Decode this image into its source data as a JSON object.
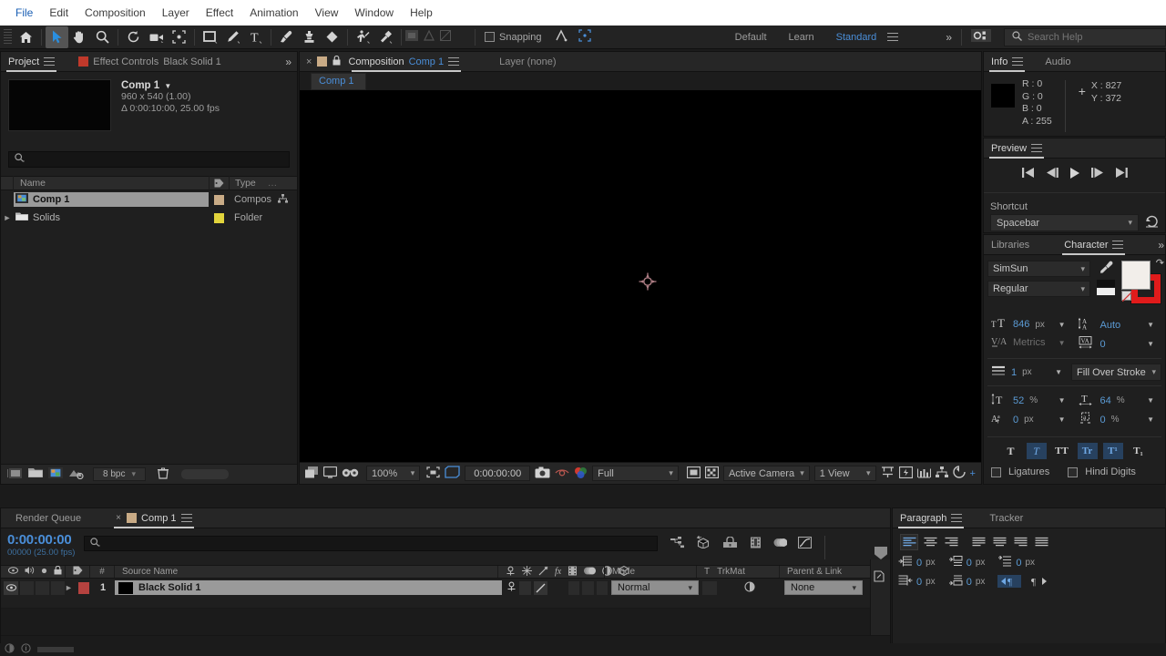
{
  "menubar": {
    "items": [
      "File",
      "Edit",
      "Composition",
      "Layer",
      "Effect",
      "Animation",
      "View",
      "Window",
      "Help"
    ]
  },
  "toolbar": {
    "tools": [
      {
        "name": "home-icon",
        "label": "Home"
      },
      {
        "name": "selection-tool-icon",
        "label": "Selection Tool"
      },
      {
        "name": "hand-tool-icon",
        "label": "Hand Tool"
      },
      {
        "name": "zoom-tool-icon",
        "label": "Zoom Tool"
      },
      {
        "name": "rotation-tool-icon",
        "label": "Rotation Tool"
      },
      {
        "name": "camera-tool-icon",
        "label": "Unified Camera Tool"
      },
      {
        "name": "pan-behind-tool-icon",
        "label": "Pan Behind Tool"
      },
      {
        "name": "shape-tool-icon",
        "label": "Rectangle Tool"
      },
      {
        "name": "pen-tool-icon",
        "label": "Pen Tool"
      },
      {
        "name": "type-tool-icon",
        "label": "Type Tool"
      },
      {
        "name": "brush-tool-icon",
        "label": "Brush Tool"
      },
      {
        "name": "clone-stamp-tool-icon",
        "label": "Clone Stamp Tool"
      },
      {
        "name": "eraser-tool-icon",
        "label": "Eraser Tool"
      },
      {
        "name": "roto-brush-tool-icon",
        "label": "Roto Brush Tool"
      },
      {
        "name": "puppet-pin-tool-icon",
        "label": "Puppet Pin Tool"
      }
    ],
    "snapping_label": "Snapping",
    "workspaces": [
      "Default",
      "Learn",
      "Standard"
    ],
    "active_workspace": "Standard",
    "overflow_label": "»",
    "search_placeholder": "Search Help",
    "search_value": ""
  },
  "project": {
    "tabs": [
      {
        "label": "Project",
        "active": true
      },
      {
        "label": "Effect Controls",
        "active": false
      },
      {
        "label": "Black Solid 1",
        "active": false
      }
    ],
    "overflow": "»",
    "header": {
      "title": "Comp 1",
      "resolution": "960 x 540 (1.00)",
      "duration": "Δ 0:00:10:00, 25.00 fps"
    },
    "search_placeholder": "",
    "columns": [
      "Name",
      "Type"
    ],
    "rows": [
      {
        "name": "Comp 1",
        "type": "Compos",
        "swatch": "#c9ab86",
        "selected": true,
        "expandable": false
      },
      {
        "name": "Solids",
        "type": "Folder",
        "swatch": "#e2d43c",
        "selected": false,
        "expandable": true
      }
    ],
    "footer": {
      "bit_depth": "8 bpc"
    }
  },
  "composition": {
    "tab_close": "×",
    "tab_label": "Composition",
    "tab_comp_name": "Comp 1",
    "layer_label": "Layer  (none)",
    "breadcrumb": "Comp 1",
    "footer": {
      "zoom": "100%",
      "timecode": "0:00:00:00",
      "resolution": "Full",
      "camera": "Active Camera",
      "views": "1 View"
    }
  },
  "info": {
    "tabs": [
      {
        "label": "Info",
        "active": true
      },
      {
        "label": "Audio",
        "active": false
      }
    ],
    "color_swatch": "#000000",
    "r": "R : 0",
    "g": "G : 0",
    "b": "B : 0",
    "a": "A : 255",
    "x": "X : 827",
    "y": "Y : 372"
  },
  "preview": {
    "tab": "Preview",
    "shortcut_label": "Shortcut",
    "shortcut_value": "Spacebar",
    "transport": [
      "first-frame",
      "prev-frame",
      "play",
      "next-frame",
      "last-frame"
    ]
  },
  "character": {
    "tabs": [
      {
        "label": "Libraries",
        "active": false
      },
      {
        "label": "Character",
        "active": true
      }
    ],
    "overflow": "»",
    "font_family": "SimSun",
    "font_style": "Regular",
    "font_size": "846",
    "font_size_unit": "px",
    "leading": "Auto",
    "kerning": "Metrics",
    "tracking": "0",
    "stroke_width": "1",
    "stroke_width_unit": "px",
    "fill_stroke_order": "Fill Over Stroke",
    "vertical_scale": "52",
    "vertical_scale_unit": "%",
    "horizontal_scale": "64",
    "horizontal_scale_unit": "%",
    "baseline_shift": "0",
    "baseline_shift_unit": "px",
    "tsume": "0",
    "tsume_unit": "%",
    "style_buttons": [
      "T",
      "T",
      "TT",
      "Tr",
      "T¹",
      "T₁"
    ],
    "ligatures_label": "Ligatures",
    "hindi_digits_label": "Hindi Digits",
    "fill_color": "#f2eeea",
    "stroke_color": "#e01b1b"
  },
  "timeline": {
    "tabs": [
      {
        "label": "Render Queue",
        "active": false
      },
      {
        "label": "Comp 1",
        "active": true
      }
    ],
    "current_time": "0:00:00:00",
    "frame_info": "00000 (25.00 fps)",
    "search_placeholder": "",
    "columns": {
      "source_name": "Source Name",
      "mode": "Mode",
      "trkmat_t": "T",
      "trkmat": "TrkMat",
      "parent_link": "Parent & Link",
      "num": "#"
    },
    "layers": [
      {
        "index": "1",
        "source_name": "Black Solid 1",
        "label_color": "#b5423f",
        "mode": "Normal",
        "parent": "None",
        "selected": true
      }
    ]
  },
  "paragraph": {
    "tabs": [
      {
        "label": "Paragraph",
        "active": true
      },
      {
        "label": "Tracker",
        "active": false
      }
    ],
    "indent_left": "0",
    "indent_right": "0",
    "indent_first": "0",
    "space_before": "0",
    "space_after": "0",
    "unit": "px"
  },
  "theme": {
    "accent_blue": "#4a8ed8",
    "panel_bg": "#1f1f1f",
    "tab_bg": "#262626",
    "canvas_bg": "#000000"
  }
}
